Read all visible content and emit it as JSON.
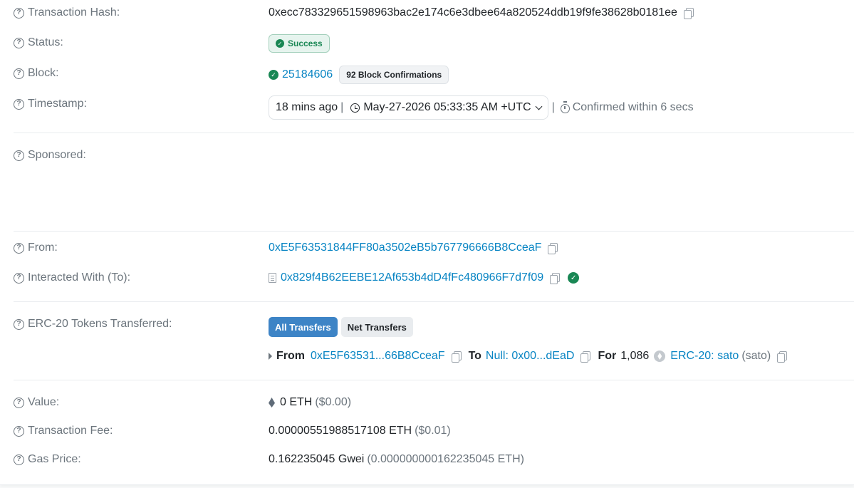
{
  "rows": {
    "tx_hash": {
      "label": "Transaction Hash:",
      "value": "0xecc783329651598963bac2e174c6e3dbee64a820524ddb19f9fe38628b0181ee"
    },
    "status": {
      "label": "Status:",
      "badge": "Success"
    },
    "block": {
      "label": "Block:",
      "number": "25184606",
      "confirmations": "92 Block Confirmations"
    },
    "timestamp": {
      "label": "Timestamp:",
      "ago": "18 mins ago",
      "datetime": "May-27-2026 05:33:35 AM +UTC",
      "confirmed": "Confirmed within 6 secs"
    },
    "sponsored": {
      "label": "Sponsored:"
    },
    "from": {
      "label": "From:",
      "address": "0xE5F63531844FF80a3502eB5b767796666B8CceaF"
    },
    "to": {
      "label": "Interacted With (To):",
      "address": "0x829f4B62EEBE12Af653b4dD4fFc480966F7d7f09"
    },
    "erc20": {
      "label": "ERC-20 Tokens Transferred:",
      "tabs": [
        "All Transfers",
        "Net Transfers"
      ],
      "transfer": {
        "from_label": "From",
        "from_addr": "0xE5F63531...66B8CceaF",
        "to_label": "To",
        "to_addr": "Null: 0x00...dEaD",
        "for_label": "For",
        "amount": "1,086",
        "token_name": "ERC-20: sato",
        "token_symbol": "(sato)"
      }
    },
    "value": {
      "label": "Value:",
      "amount": "0 ETH",
      "usd": "($0.00)"
    },
    "fee": {
      "label": "Transaction Fee:",
      "amount": "0.00000551988517108 ETH",
      "usd": "($0.01)"
    },
    "gas": {
      "label": "Gas Price:",
      "gwei": "0.162235045 Gwei",
      "eth": "(0.000000000162235045 ETH)"
    }
  },
  "icons": {
    "help": "question-circle-icon",
    "copy": "copy-icon",
    "check": "check-circle-icon",
    "clock": "clock-icon",
    "stopwatch": "stopwatch-icon",
    "contract": "contract-document-icon",
    "eth": "ethereum-icon",
    "token": "token-icon"
  },
  "colors": {
    "link": "#0784c3",
    "success": "#198754",
    "tab_active": "#3d84c6",
    "muted": "#6c757d"
  }
}
